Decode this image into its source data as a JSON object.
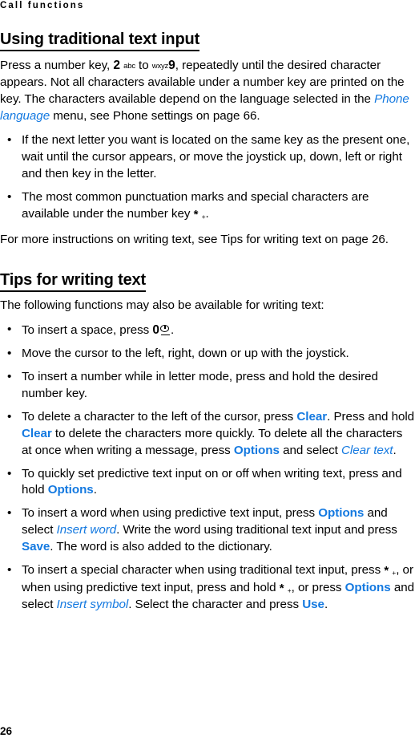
{
  "document": {
    "running_header": "Call functions",
    "page_number": "26",
    "link_color": "#1479e0",
    "text_color": "#000000"
  },
  "sections": [
    {
      "heading": "Using traditional text input",
      "intro": {
        "part1": "Press a number key, ",
        "key2_digit": "2",
        "key2_letters": "abc",
        "part2": " to ",
        "key9_letters": "wxyz",
        "key9_digit": "9",
        "part3": ", repeatedly until the desired character appears. Not all characters available under a number key are printed on the key. The characters available depend on the language selected in the ",
        "link_phone_language": "Phone language",
        "part4": " menu, see Phone settings on page 66."
      },
      "bullets": [
        {
          "text": "If the next letter you want is located on the same key as the present one, wait until the cursor appears, or move the joystick up, down, left or right and then key in the letter."
        },
        {
          "prefix": " The most common punctuation marks and special characters are available under the number key ",
          "star_key": "*",
          "star_sub": "+",
          "suffix": "."
        }
      ],
      "closing": "For more instructions on writing text, see Tips for writing text on page 26."
    },
    {
      "heading": "Tips for writing text",
      "intro_text": "The following functions may also be available for writing text:",
      "bullets": [
        {
          "id": "insert-space",
          "prefix": "To insert a space, press ",
          "key_digit": "0",
          "key_glyph": "space-key-icon",
          "suffix": "."
        },
        {
          "id": "move-cursor",
          "text": "Move the cursor to the left, right, down or up with the joystick."
        },
        {
          "id": "insert-number",
          "text": "To insert a number while in letter mode, press and hold the desired number key."
        },
        {
          "id": "delete-character",
          "p1": "To delete a character to the left of the cursor, press ",
          "l1": "Clear",
          "p2": ". Press and hold ",
          "l2": "Clear",
          "p3": " to delete the characters more quickly. To delete all the characters at once when writing a message, press ",
          "l3": "Options",
          "p4": " and select ",
          "i1": "Clear text",
          "p5": "."
        },
        {
          "id": "toggle-predictive",
          "p1": " To quickly set predictive text input on or off when writing text, press and hold ",
          "l1": "Options",
          "p2": "."
        },
        {
          "id": "insert-word",
          "p1": "To insert a word when using predictive text input, press ",
          "l1": "Options",
          "p2": " and select ",
          "i1": "Insert word",
          "p3": ". Write the word using traditional text input and press ",
          "l2": "Save",
          "p4": ". The word is also added to the dictionary."
        },
        {
          "id": "insert-special-character",
          "p1": "To insert a special character when using traditional text input, press ",
          "star1": "*",
          "star1_sub": "+",
          "p2": ", or when using predictive text input, press and hold ",
          "star2": "*",
          "star2_sub": "+",
          "p3": ", or press ",
          "l1": "Options",
          "p4": " and select ",
          "i1": "Insert symbol",
          "p5": ". Select the character and press ",
          "l2": "Use",
          "p6": "."
        }
      ]
    }
  ]
}
